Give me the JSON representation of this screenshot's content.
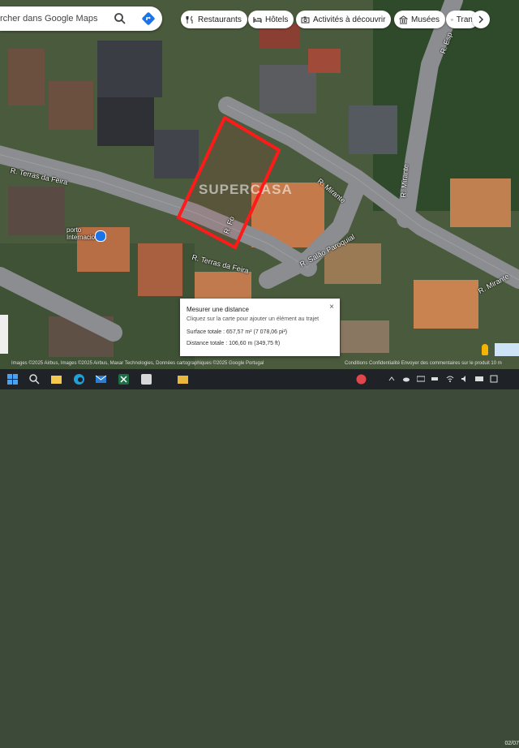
{
  "search": {
    "value": "rcher dans Google Maps",
    "search_icon": "search-icon",
    "directions_icon": "directions-icon"
  },
  "chips": [
    {
      "label": "Restaurants",
      "icon": "restaurant-icon"
    },
    {
      "label": "Hôtels",
      "icon": "hotel-icon"
    },
    {
      "label": "Activités à découvrir",
      "icon": "camera-icon"
    },
    {
      "label": "Musées",
      "icon": "museum-icon"
    },
    {
      "label": "Tran",
      "icon": "transit-icon"
    }
  ],
  "chips_next_icon": "chevron-right-icon",
  "streets": {
    "terras_feira_1": "R. Terras da Feira",
    "terras_feira_2": "R. Terras da Feira",
    "mirante_1": "R. Mirante",
    "mirante_2": "R. Mirante",
    "mirante_3": "R. Mirante",
    "salao_paroquial": "R. Salão Paroquial",
    "side_street": "R. Fo",
    "top_right": "R. Esp"
  },
  "poi": {
    "name": "porto Internacional"
  },
  "watermark": "SUPERCASA",
  "measure": {
    "title": "Mesurer une distance",
    "hint": "Cliquez sur la carte pour ajouter un élément au trajet",
    "area": "Surface totale : 657,57 m² (7 078,06 pi²)",
    "distance": "Distance totale : 106,60 m (349,75 ft)",
    "close": "×"
  },
  "credits": {
    "left": "Images ©2025 Airbus, Images ©2025 Airbus, Maxar Technologies, Données cartographiques ©2025 Google   Portugal",
    "right": "Conditions   Confidentialité   Envoyer des commentaires sur le produit   10 m"
  },
  "colors": {
    "highlight": "#ff1a1a",
    "chip_bg": "#ffffff",
    "taskbar": "#1f2227"
  },
  "taskbar": {
    "apps": [
      "start-icon",
      "search-icon",
      "file-explorer-icon",
      "edge-icon",
      "mail-icon",
      "excel-icon",
      "word-icon",
      "media-icon",
      "folder-icon"
    ],
    "clock": "02/07"
  }
}
